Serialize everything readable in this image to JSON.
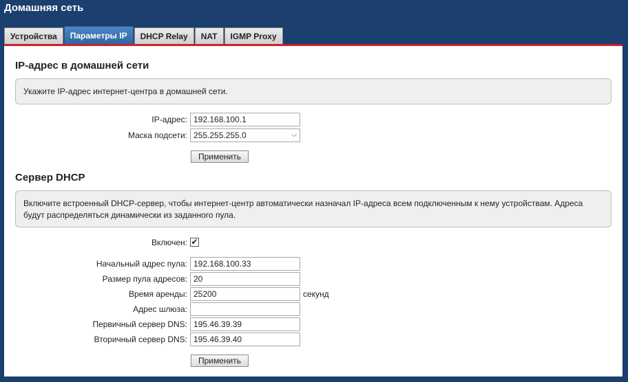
{
  "header": {
    "title": "Домашняя сеть"
  },
  "tabs": [
    {
      "label": "Устройства"
    },
    {
      "label": "Параметры IP"
    },
    {
      "label": "DHCP Relay"
    },
    {
      "label": "NAT"
    },
    {
      "label": "IGMP Proxy"
    }
  ],
  "ip_section": {
    "title": "IP-адрес в домашней сети",
    "info": "Укажите IP-адрес интернет-центра в домашней сети.",
    "ip_label": "IP-адрес:",
    "ip_value": "192.168.100.1",
    "mask_label": "Маска подсети:",
    "mask_value": "255.255.255.0",
    "apply_label": "Применить"
  },
  "dhcp_section": {
    "title": "Сервер DHCP",
    "info": "Включите встроенный DHCP-сервер, чтобы интернет-центр автоматически назначал IP-адреса всем подключенным к нему устройствам. Адреса будут распределяться динамически из заданного пула.",
    "enabled_label": "Включен:",
    "enabled_checked": true,
    "checkmark": "✔",
    "pool_start_label": "Начальный адрес пула:",
    "pool_start_value": "192.168.100.33",
    "pool_size_label": "Размер пула адресов:",
    "pool_size_value": "20",
    "lease_label": "Время аренды:",
    "lease_value": "25200",
    "lease_unit": "секунд",
    "gateway_label": "Адрес шлюза:",
    "gateway_value": "",
    "dns1_label": "Первичный сервер DNS:",
    "dns1_value": "195.46.39.39",
    "dns2_label": "Вторичный сервер DNS:",
    "dns2_value": "195.46.39.40",
    "apply_label": "Применить"
  }
}
